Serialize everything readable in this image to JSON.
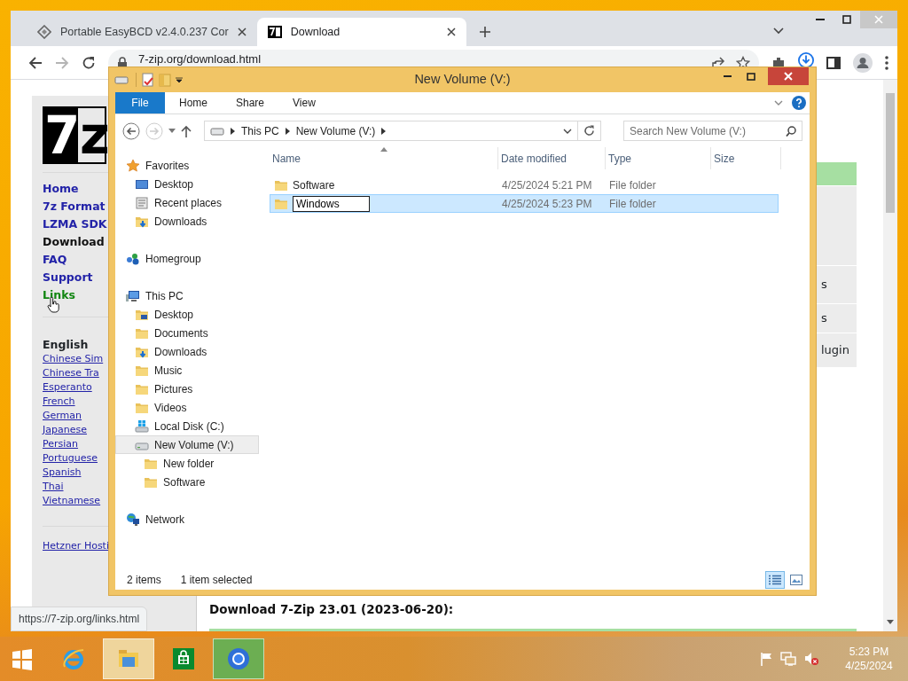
{
  "browser": {
    "tabs": [
      {
        "title": "Portable EasyBCD v2.4.0.237 Cor",
        "selected": false,
        "kind": "diamond"
      },
      {
        "title": "Download",
        "selected": true,
        "kind": "app"
      }
    ],
    "address": "7-zip.org/download.html",
    "site": {
      "logo": [
        "7",
        "z"
      ],
      "nav": [
        {
          "label": "Home",
          "kind": "link"
        },
        {
          "label": "7z Format",
          "kind": "link"
        },
        {
          "label": "LZMA SDK",
          "kind": "link"
        },
        {
          "label": "Download",
          "kind": "current"
        },
        {
          "label": "FAQ",
          "kind": "link"
        },
        {
          "label": "Support",
          "kind": "link"
        },
        {
          "label": "Links",
          "kind": "hover"
        }
      ],
      "language_heading": "English",
      "languages": [
        "Chinese Sim",
        "Chinese Tra",
        "Esperanto",
        "French",
        "German",
        "Japanese",
        "Persian",
        "Portuguese",
        "Spanish",
        "Thai",
        "Vietnamese"
      ],
      "sponsor": "Hetzner Hosti",
      "table_fragments": [
        "s",
        "s",
        "lugin"
      ],
      "download_heading": "Download 7-Zip 23.01 (2023-06-20):"
    },
    "status_url": "https://7-zip.org/links.html"
  },
  "explorer": {
    "title": "New Volume (V:)",
    "ribbon_tabs": [
      {
        "label": "File",
        "kind": "file"
      },
      {
        "label": "Home",
        "kind": "tab"
      },
      {
        "label": "Share",
        "kind": "tab"
      },
      {
        "label": "View",
        "kind": "tab"
      }
    ],
    "breadcrumb": [
      "This PC",
      "New Volume (V:)"
    ],
    "search": {
      "placeholder": "Search New Volume (V:)"
    },
    "nav_tree": [
      {
        "label": "Favorites",
        "kind": "star",
        "selected": false,
        "children": [
          {
            "label": "Desktop",
            "kind": "desktop",
            "selected": false
          },
          {
            "label": "Recent places",
            "kind": "recent",
            "selected": false
          },
          {
            "label": "Downloads",
            "kind": "downloads",
            "selected": false
          }
        ]
      },
      {
        "label": "Homegroup",
        "kind": "homegroup",
        "selected": false
      },
      {
        "label": "This PC",
        "kind": "pc",
        "selected": false,
        "children": [
          {
            "label": "Desktop",
            "kind": "desktop-folder",
            "selected": false
          },
          {
            "label": "Documents",
            "kind": "folder",
            "selected": false
          },
          {
            "label": "Downloads",
            "kind": "downloads",
            "selected": false
          },
          {
            "label": "Music",
            "kind": "folder",
            "selected": false
          },
          {
            "label": "Pictures",
            "kind": "folder",
            "selected": false
          },
          {
            "label": "Videos",
            "kind": "folder",
            "selected": false
          },
          {
            "label": "Local Disk (C:)",
            "kind": "system-drive",
            "selected": false
          },
          {
            "label": "New Volume (V:)",
            "kind": "drive",
            "selected": true,
            "children": [
              {
                "label": "New folder",
                "kind": "folder",
                "selected": false
              },
              {
                "label": "Software",
                "kind": "folder",
                "selected": false
              }
            ]
          }
        ]
      },
      {
        "label": "Network",
        "kind": "network",
        "selected": false
      }
    ],
    "columns": [
      {
        "label": "Name",
        "sorted": true
      },
      {
        "label": "Date modified",
        "sorted": false
      },
      {
        "label": "Type",
        "sorted": false
      },
      {
        "label": "Size",
        "sorted": false
      }
    ],
    "rows": [
      {
        "name": "Software",
        "date_modified": "4/25/2024 5:21 PM",
        "type": "File folder",
        "selected": false,
        "renaming": false
      },
      {
        "name": "Windows",
        "date_modified": "4/25/2024 5:23 PM",
        "type": "File folder",
        "selected": true,
        "renaming": true
      }
    ],
    "status": {
      "count": "2 items",
      "selection": "1 item selected"
    },
    "views": [
      {
        "kind": "details",
        "selected": true
      },
      {
        "kind": "large-icons",
        "selected": false
      }
    ]
  },
  "taskbar": {
    "items": [
      {
        "kind": "start",
        "active": false
      },
      {
        "kind": "ie",
        "active": false
      },
      {
        "kind": "explorer",
        "active": true,
        "color": "#efd59c"
      },
      {
        "kind": "store",
        "active": false
      },
      {
        "kind": "chrome",
        "active": true,
        "color": "#6cae52"
      }
    ],
    "clock": {
      "time": "5:23 PM",
      "date": "4/25/2024"
    }
  }
}
